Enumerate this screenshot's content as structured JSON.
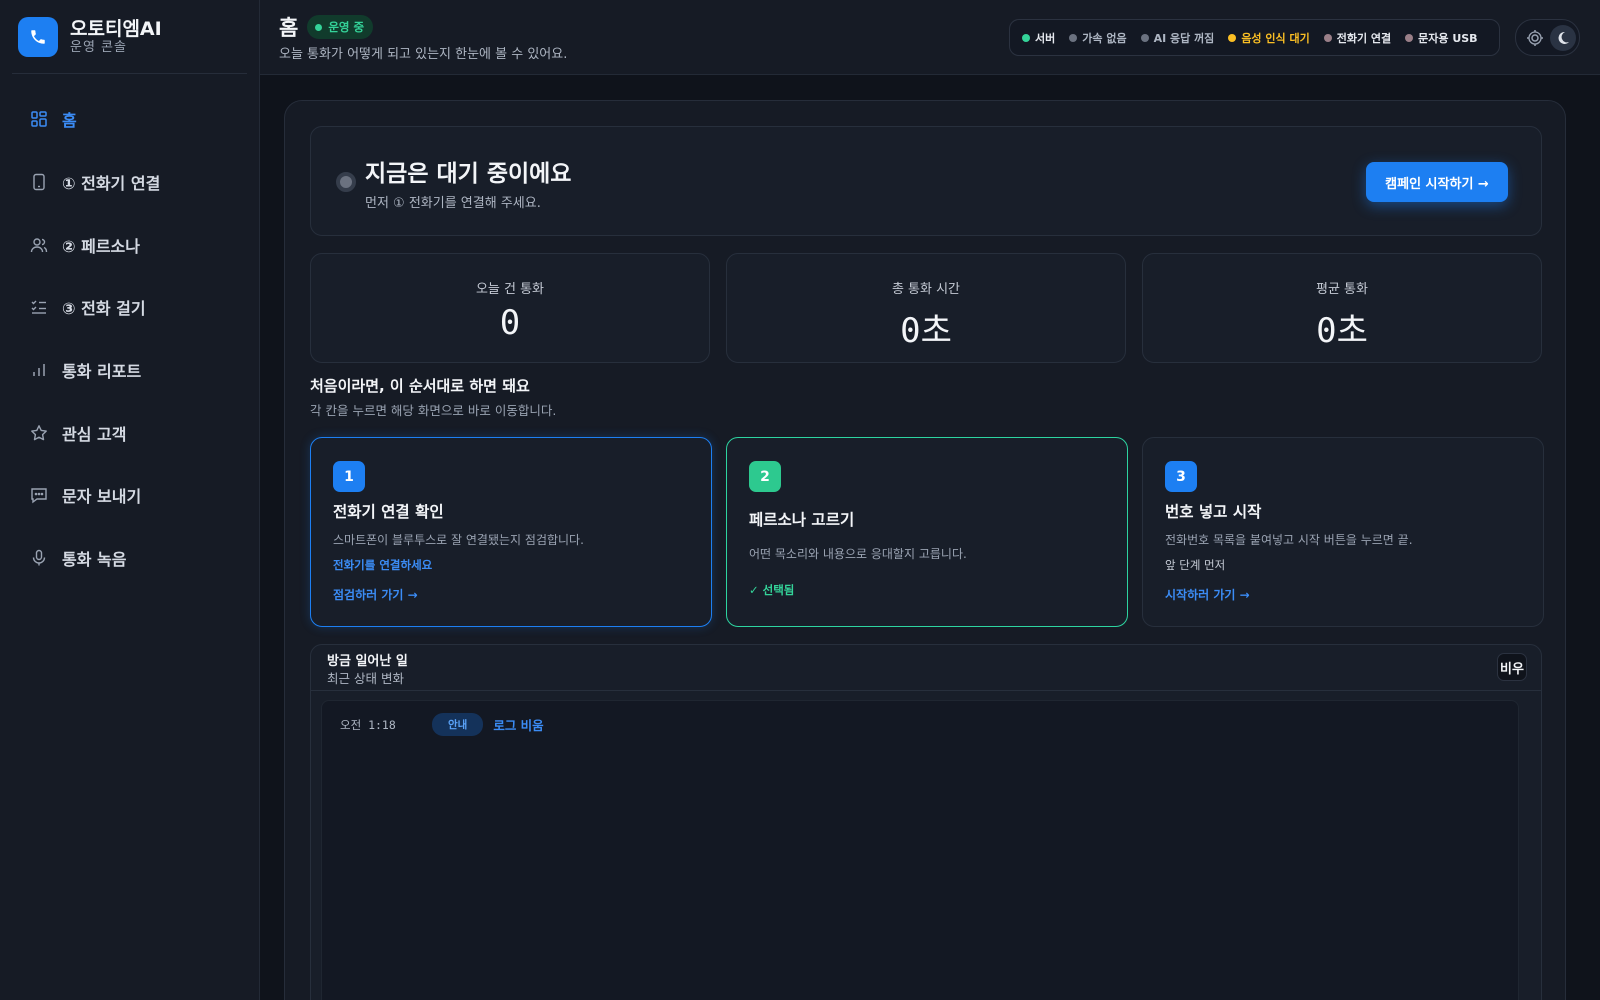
{
  "brand": {
    "name": "오토티엠AI",
    "subtitle": "운영 콘솔",
    "accent": "#1d7ff2"
  },
  "sidebar": {
    "items": [
      {
        "label": "홈",
        "icon": "home-grid-icon",
        "active": true
      },
      {
        "label": "① 전화기 연결",
        "icon": "phone-device-icon",
        "active": false
      },
      {
        "label": "② 페르소나",
        "icon": "users-icon",
        "active": false
      },
      {
        "label": "③ 전화 걸기",
        "icon": "checklist-icon",
        "active": false
      },
      {
        "label": "통화 리포트",
        "icon": "bar-chart-icon",
        "active": false
      },
      {
        "label": "관심 고객",
        "icon": "star-icon",
        "active": false
      },
      {
        "label": "문자 보내기",
        "icon": "message-icon",
        "active": false
      },
      {
        "label": "통화 녹음",
        "icon": "microphone-icon",
        "active": false
      }
    ]
  },
  "header": {
    "title": "홈",
    "status": "운영 중",
    "subtitle": "오늘 통화가 어떻게 되고 있는지 한눈에 볼 수 있어요.",
    "system": [
      {
        "label": "서버",
        "color": "#34d399",
        "text_color": "#e6e9ef"
      },
      {
        "label": "가속 없음",
        "color": "#6b7280",
        "text_color": "#aeb6c3"
      },
      {
        "label": "AI 응답 꺼짐",
        "color": "#6b7280",
        "text_color": "#aeb6c3"
      },
      {
        "label": "음성 인식 대기",
        "color": "#fbbf24",
        "text_color": "#fbbf24"
      },
      {
        "label": "전화기 연결",
        "color": "#9a7f88",
        "text_color": "#e6e9ef"
      },
      {
        "label": "문자용 USB",
        "color": "#9a7f88",
        "text_color": "#e6e9ef"
      }
    ]
  },
  "hero": {
    "title": "지금은 대기 중이에요",
    "subtitle": "먼저 ① 전화기를 연결해 주세요.",
    "button": "캠페인 시작하기 →"
  },
  "stats": [
    {
      "label": "오늘 건 통화",
      "value": "0"
    },
    {
      "label": "총 통화 시간",
      "value": "0초"
    },
    {
      "label": "평균 통화",
      "value": "0초"
    }
  ],
  "guide": {
    "title": "처음이라면, 이 순서대로 하면 돼요",
    "subtitle": "각 칸을 누르면 해당 화면으로 바로 이동합니다."
  },
  "steps": [
    {
      "num": "1",
      "title": "전화기 연결 확인",
      "desc": "스마트폰이 블루투스로 잘 연결됐는지 점검합니다.",
      "status": "전화기를 연결하세요",
      "link": "점검하러 가기 →",
      "color": "#1d7ff2"
    },
    {
      "num": "2",
      "title": "페르소나 고르기",
      "desc": "어떤 목소리와 내용으로 응대할지 고릅니다.",
      "status": "✓ 선택됨",
      "link": "",
      "color": "#2dc98f"
    },
    {
      "num": "3",
      "title": "번호 넣고 시작",
      "desc": "전화번호 목록을 붙여넣고 시작 버튼을 누르면 끝.",
      "status": "앞 단계 먼저",
      "link": "시작하러 가기 →",
      "color": "#1d7ff2"
    }
  ],
  "activity": {
    "title": "방금 일어난 일",
    "subtitle": "최근 상태 변화",
    "clear_button": "비우",
    "log": [
      {
        "time": "오전 1:18",
        "tag": "안내",
        "message": "로그 비움"
      }
    ]
  }
}
